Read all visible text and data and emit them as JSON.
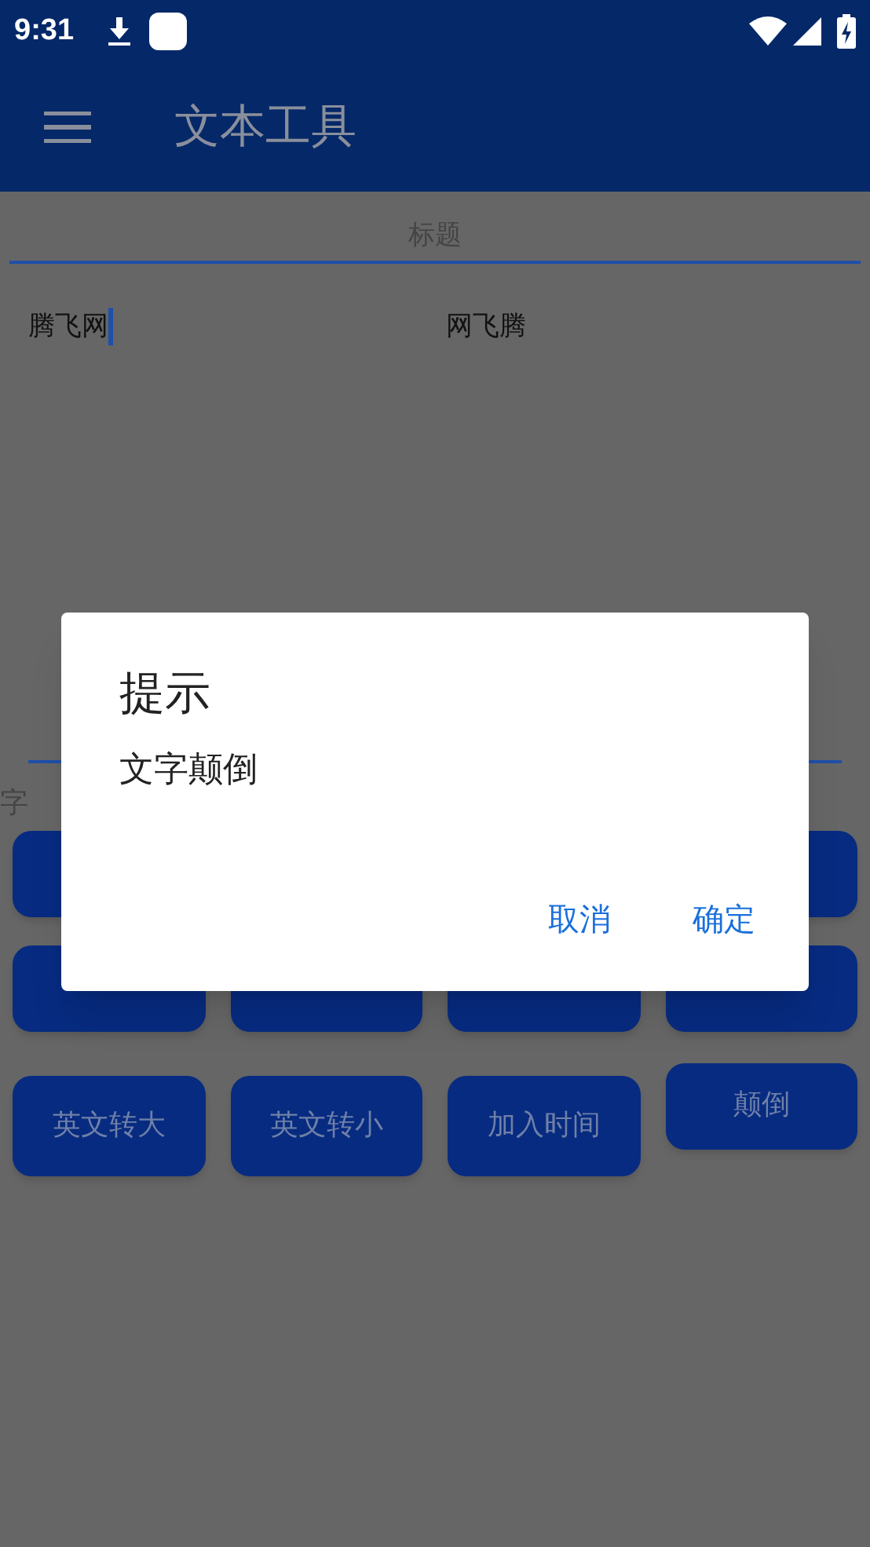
{
  "status_bar": {
    "time": "9:31"
  },
  "app_bar": {
    "title": "文本工具"
  },
  "title_field": {
    "placeholder": "标题"
  },
  "text_left": {
    "value": "腾飞网",
    "focused": true
  },
  "text_right": {
    "value": "网飞腾"
  },
  "count_label": "字",
  "button_rows": [
    [
      {
        "kind": "blank"
      },
      {
        "kind": "covered"
      },
      {
        "kind": "covered"
      },
      {
        "kind": "blank"
      }
    ],
    [
      {
        "kind": "blank"
      },
      {
        "kind": "blank"
      },
      {
        "kind": "blank"
      },
      {
        "kind": "blank"
      }
    ],
    [
      {
        "kind": "text",
        "label": "英文转大"
      },
      {
        "kind": "text",
        "label": "英文转小"
      },
      {
        "kind": "text",
        "label": "加入时间"
      },
      {
        "kind": "text",
        "label": "颠倒"
      }
    ]
  ],
  "dialog": {
    "title": "提示",
    "message": "文字颠倒",
    "buttons": [
      "取消",
      "确定"
    ]
  }
}
